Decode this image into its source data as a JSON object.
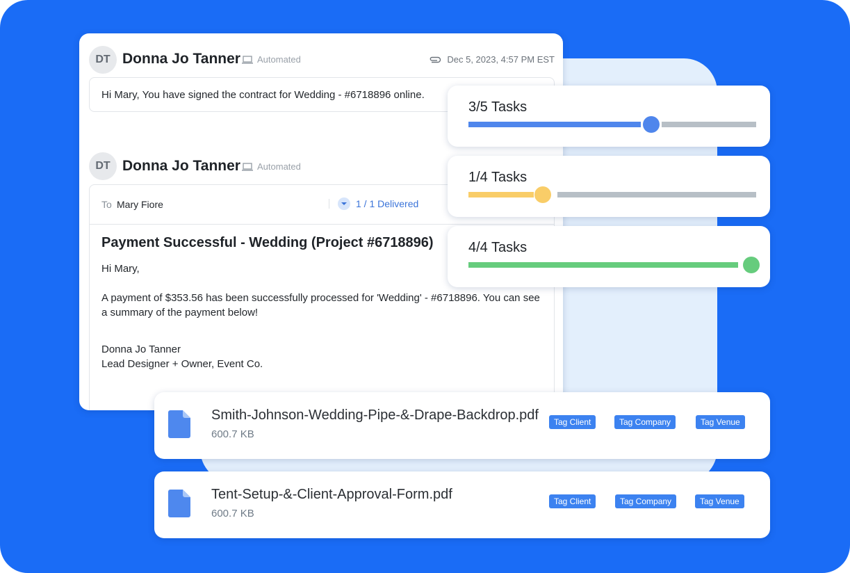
{
  "colors": {
    "background": "#1a6cf6",
    "backplate": "#e3effc",
    "accent_blue": "#4f86ec",
    "accent_yellow": "#f9cd68",
    "accent_green": "#66cc7d",
    "track_gray": "#b7bfc6",
    "tag_blue": "#3c82f0"
  },
  "messages": [
    {
      "avatar_initials": "DT",
      "sender": "Donna Jo Tanner",
      "tag": "Automated",
      "tag_icon": "laptop-icon",
      "date_icon": "paperclip-icon",
      "date": "Dec 5, 2023, 4:57 PM EST",
      "body": "Hi Mary,  You have signed the contract for Wedding - #6718896 online."
    },
    {
      "avatar_initials": "DT",
      "sender": "Donna Jo Tanner",
      "tag": "Automated",
      "tag_icon": "laptop-icon",
      "to_label": "To",
      "to_name": "Mary Fiore",
      "delivered_icon": "chevron-down-icon",
      "delivered": "1 / 1 Delivered",
      "subject": "Payment Successful - Wedding (Project #6718896)",
      "greeting": "Hi Mary,",
      "paragraph": "A payment of $353.56 has been successfully processed for 'Wedding' - #6718896. You can see a summary of the payment below!",
      "signature_name": "Donna Jo Tanner",
      "signature_title": "Lead Designer + Owner, Event Co."
    }
  ],
  "tasks": [
    {
      "label": "3/5 Tasks",
      "done": 3,
      "total": 5,
      "progress": 0.6,
      "color": "#4f86ec"
    },
    {
      "label": "1/4 Tasks",
      "done": 1,
      "total": 4,
      "progress": 0.25,
      "color": "#f9cd68"
    },
    {
      "label": "4/4 Tasks",
      "done": 4,
      "total": 4,
      "progress": 1.0,
      "color": "#66cc7d"
    }
  ],
  "files": [
    {
      "icon": "file-icon",
      "name": "Smith-Johnson-Wedding-Pipe-&-Drape-Backdrop.pdf",
      "size": "600.7 KB",
      "tags": [
        "Tag Client",
        "Tag Company",
        "Tag Venue"
      ]
    },
    {
      "icon": "file-icon",
      "name": "Tent-Setup-&-Client-Approval-Form.pdf",
      "size": "600.7 KB",
      "tags": [
        "Tag Client",
        "Tag Company",
        "Tag Venue"
      ]
    }
  ]
}
